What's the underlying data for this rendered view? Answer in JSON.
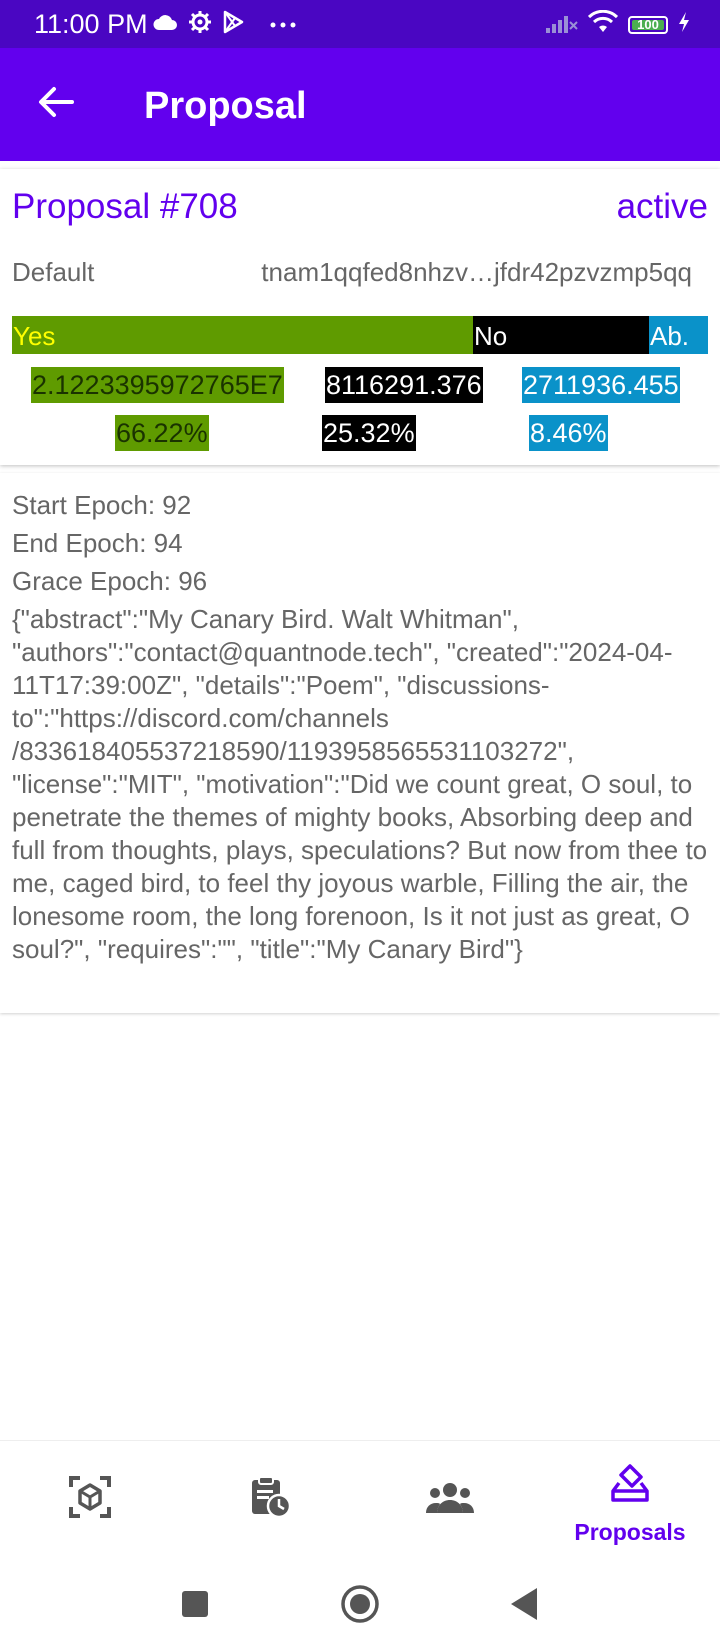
{
  "status_bar": {
    "time": "11:00 PM",
    "battery": "100",
    "left_icons": [
      "cloud-icon",
      "gear-icon",
      "play-store-icon",
      "more-icon"
    ],
    "right_icons": [
      "signal-icon",
      "wifi-icon",
      "battery-icon",
      "charging-icon"
    ]
  },
  "app_bar": {
    "title": "Proposal",
    "back_icon": "arrow-left-icon"
  },
  "proposal": {
    "id": "Proposal #708",
    "status": "active",
    "type": "Default",
    "author": "tnam1qqfed8nhzv…jfdr42pzvzmp5qq",
    "votes": {
      "yes_label": "Yes",
      "no_label": "No",
      "abstain_label": "Ab.",
      "yes_amount": "2.1223395972765E7",
      "no_amount": "8116291.376",
      "abstain_amount": "2711936.455",
      "yes_percent": "66.22%",
      "no_percent": "25.32%",
      "abstain_percent": "8.46%",
      "yes_fraction": 0.6622,
      "no_fraction": 0.2532,
      "abstain_fraction": 0.0846
    },
    "start_epoch": "Start Epoch: 92",
    "end_epoch": "End Epoch: 94",
    "grace_epoch": "Grace Epoch: 96",
    "content": "{\"abstract\":\"My Canary Bird. Walt Whitman\", \"authors\":\"contact@quantnode.tech\", \"created\":\"2024-04-11T17:39:00Z\", \"details\":\"Poem\", \"discussions-to\":\"https://discord.com/channels /833618405537218590/1193958565531103272\", \"license\":\"MIT\", \"motivation\":\"Did we count great, O soul, to penetrate the themes of mighty books, Absorbing deep and full from thoughts, plays, speculations? But now from thee to me, caged bird, to feel thy joyous warble, Filling the air, the lonesome room, the long forenoon, Is it not just as great, O soul?\", \"requires\":\"\", \"title\":\"My Canary Bird\"}"
  },
  "bottom_nav": {
    "items": [
      {
        "icon": "blocks-scan-icon",
        "label": ""
      },
      {
        "icon": "epoch-clipboard-icon",
        "label": ""
      },
      {
        "icon": "validators-group-icon",
        "label": ""
      },
      {
        "icon": "proposals-vote-icon",
        "label": "Proposals"
      }
    ],
    "active_index": 3
  },
  "colors": {
    "primary": "#6200ee",
    "status_bar": "#4a06c2",
    "yes": "#5f9b00",
    "no": "#000000",
    "abstain": "#0a92c9"
  }
}
